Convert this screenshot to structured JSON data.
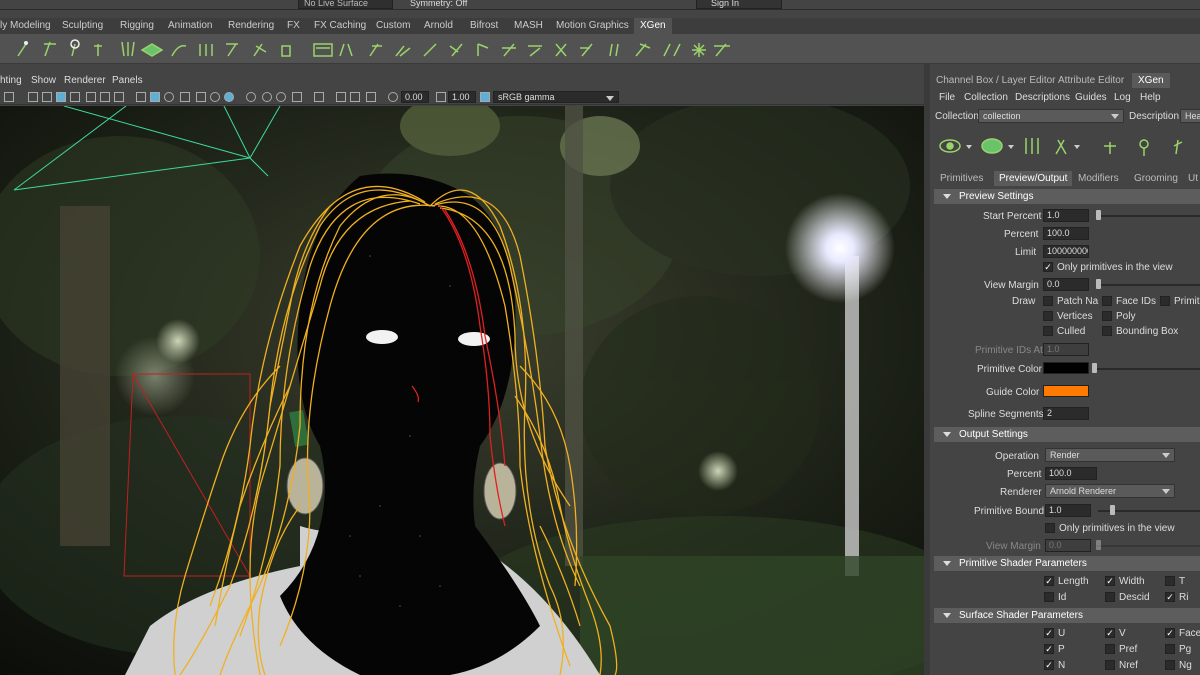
{
  "top": {
    "live_surface": "No Live Surface",
    "symmetry": "Symmetry: Off",
    "sign_in": "Sign In"
  },
  "shelf_tabs": [
    "ly Modeling",
    "Sculpting",
    "Rigging",
    "Animation",
    "Rendering",
    "FX",
    "FX Caching",
    "Custom",
    "Arnold",
    "Bifrost",
    "MASH",
    "Motion Graphics",
    "XGen"
  ],
  "active_shelf_tab": "XGen",
  "viewport": {
    "menu": [
      "hting",
      "Show",
      "Renderer",
      "Panels"
    ],
    "exposure": "0.00",
    "gamma_value": "1.00",
    "color_space": "sRGB gamma"
  },
  "right_panel": {
    "tabs": [
      "Channel Box / Layer Editor",
      "Attribute Editor",
      "XGen"
    ],
    "active_tab": "XGen",
    "menu": [
      "File",
      "Collection",
      "Descriptions",
      "Guides",
      "Log",
      "Help"
    ],
    "collection_label": "Collection",
    "collection_value": "collection",
    "description_label": "Description",
    "description_value": "Head",
    "subtabs": [
      "Primitives",
      "Preview/Output",
      "Modifiers",
      "Grooming",
      "Ut"
    ],
    "active_subtab": "Preview/Output",
    "preview_settings": {
      "header": "Preview Settings",
      "start_percent_label": "Start Percent",
      "start_percent": "1.0",
      "start_percent_pct": 1,
      "percent_label": "Percent",
      "percent": "100.0",
      "limit_label": "Limit",
      "limit": "100000000",
      "only_primitives_label": "Only primitives in the view",
      "view_margin_label": "View Margin",
      "view_margin": "0.0",
      "draw_label": "Draw",
      "draw_opts": [
        "Patch Na",
        "Face IDs",
        "Primitive",
        "Vertices",
        "Poly",
        "Culled",
        "Bounding Box"
      ],
      "prim_ids_label": "Primitive IDs At",
      "prim_ids": "1.0",
      "primitive_color_label": "Primitive Color",
      "primitive_color": "#000000",
      "guide_color_label": "Guide Color",
      "guide_color": "#ff7a00",
      "spline_segments_label": "Spline Segments",
      "spline_segments": "2"
    },
    "output_settings": {
      "header": "Output Settings",
      "operation_label": "Operation",
      "operation": "Render",
      "percent_label": "Percent",
      "percent": "100.0",
      "renderer_label": "Renderer",
      "renderer": "Arnold Renderer",
      "primitive_bound_label": "Primitive Bound",
      "primitive_bound": "1.0",
      "only_primitives_label": "Only primitives in the view",
      "view_margin_label": "View Margin",
      "view_margin": "0.0"
    },
    "primitive_shader": {
      "header": "Primitive Shader Parameters",
      "items": [
        "Length",
        "Width",
        "T",
        "Id",
        "Descid",
        "Ri"
      ]
    },
    "surface_shader": {
      "header": "Surface Shader Parameters",
      "items": [
        "U",
        "V",
        "Faceid",
        "P",
        "Pref",
        "Pg",
        "N",
        "Nref",
        "Ng"
      ]
    }
  },
  "colors": {
    "accent": "#ff7a00",
    "hair": "#f0b020",
    "guide": "#e02020",
    "camera": "#3fd99a"
  }
}
